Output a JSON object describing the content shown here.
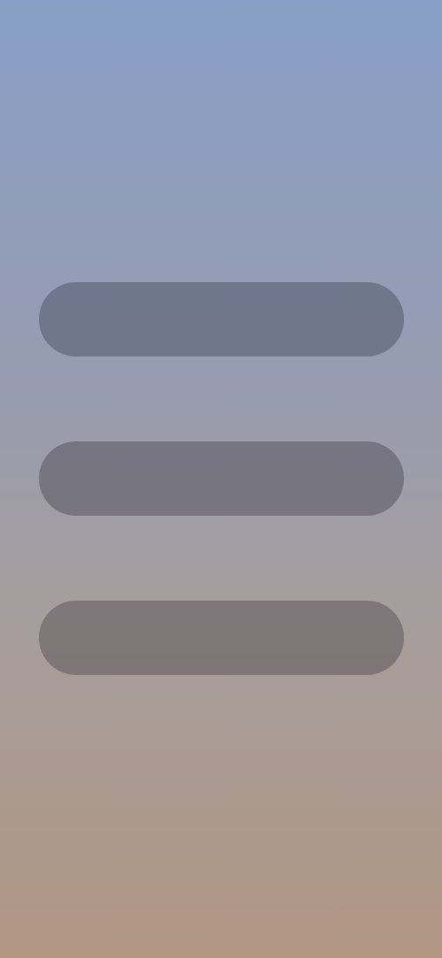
{
  "screen": {
    "colors": {
      "background_top": "#899fc7",
      "background_mid": "#979cb0",
      "background_bottom": "#b19683",
      "pill_1": "#757b8c",
      "pill_2": "#7c7983",
      "pill_3": "#837a79"
    },
    "pills": [
      {
        "label": ""
      },
      {
        "label": ""
      },
      {
        "label": ""
      }
    ]
  }
}
